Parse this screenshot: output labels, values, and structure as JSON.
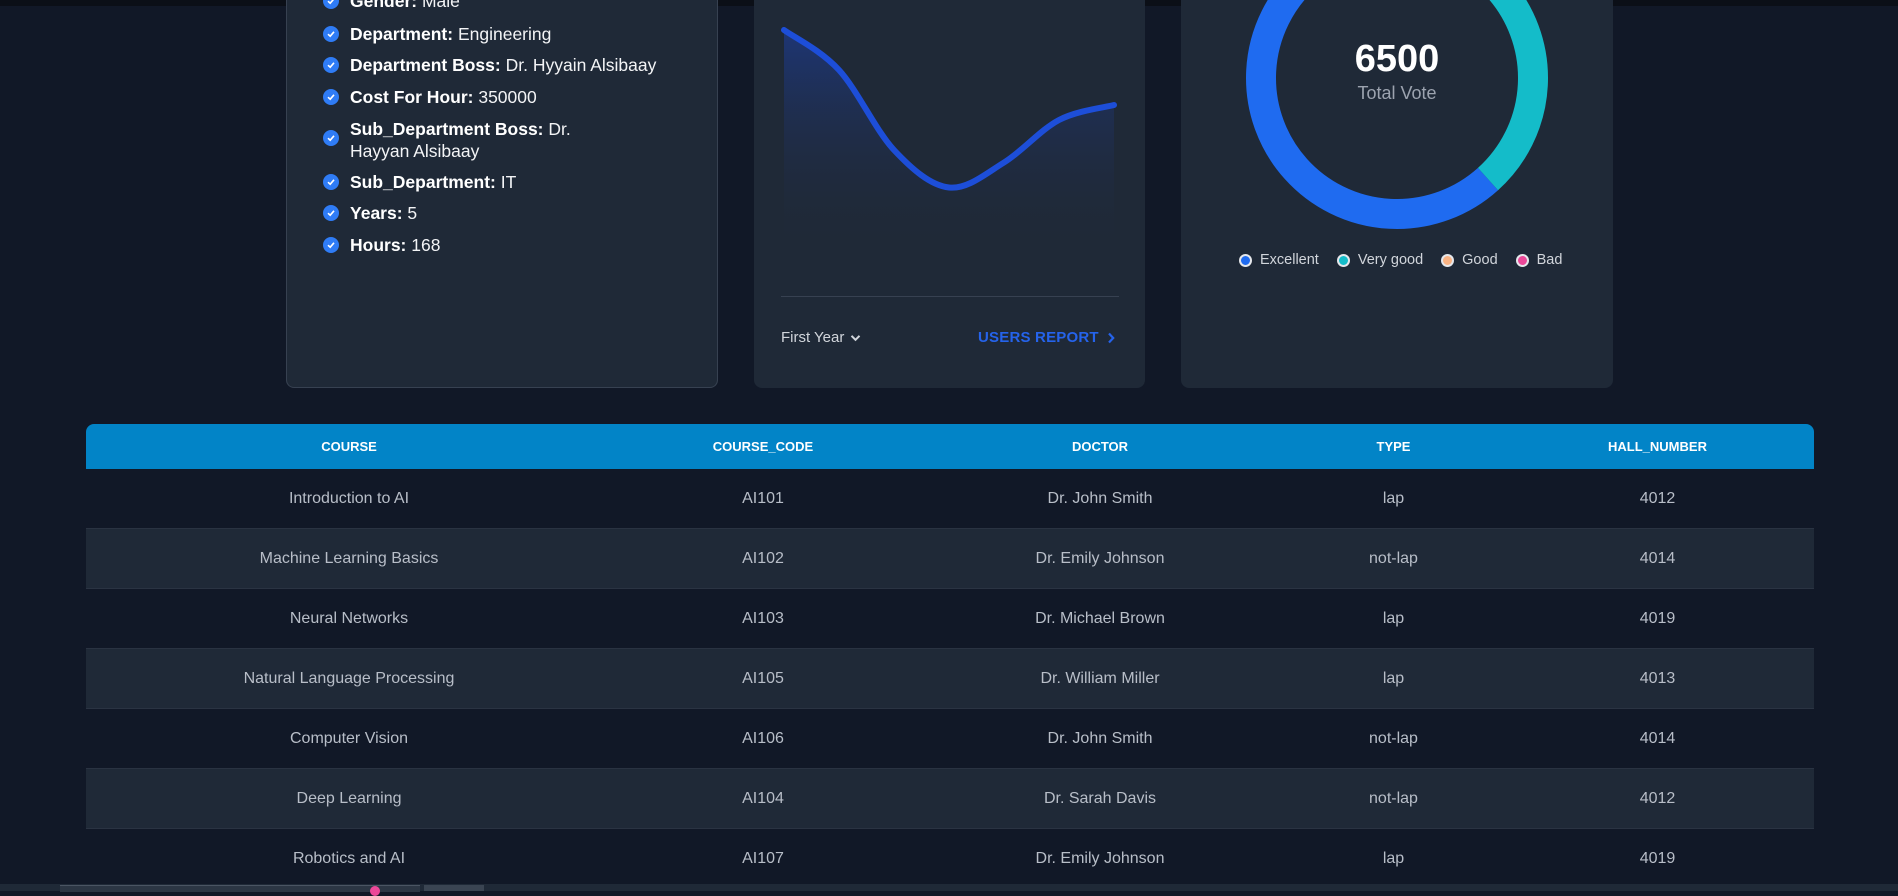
{
  "info": {
    "items": [
      {
        "key": "Gender:",
        "value": "Male"
      },
      {
        "key": "Department:",
        "value": "Engineering"
      },
      {
        "key": "Department Boss:",
        "value": "Dr. Hyyain Alsibaay"
      },
      {
        "key": "Cost For Hour:",
        "value": "350000"
      },
      {
        "key": "Sub_Department Boss:",
        "value": "Dr. Hayyan Alsibaay"
      },
      {
        "key": "Sub_Department:",
        "value": "IT"
      },
      {
        "key": "Years:",
        "value": "5"
      },
      {
        "key": "Hours:",
        "value": "168"
      }
    ]
  },
  "report": {
    "period_select": "First Year",
    "link_label": "USERS REPORT",
    "line_color": "#1d4ed8",
    "chart_data": {
      "type": "area",
      "series": [
        {
          "values": [
            88,
            72,
            40,
            25,
            35,
            52,
            58
          ]
        }
      ],
      "ylim": [
        0,
        100
      ],
      "grid": false
    }
  },
  "vote": {
    "total": "6500",
    "total_label": "Total Vote",
    "chart_data": {
      "type": "pie",
      "categories": [
        "Excellent",
        "Very good",
        "Good",
        "Bad"
      ],
      "values": [
        62,
        38,
        0,
        0
      ],
      "colors": [
        "#1f6bf0",
        "#14bcc9",
        "#f9b384",
        "#ec4899"
      ]
    },
    "legend": [
      {
        "label": "Excellent",
        "color": "#1f6bf0"
      },
      {
        "label": "Very good",
        "color": "#14bcc9"
      },
      {
        "label": "Good",
        "color": "#f9b384"
      },
      {
        "label": "Bad",
        "color": "#ec4899"
      }
    ]
  },
  "table": {
    "headers": [
      "COURSE",
      "COURSE_CODE",
      "DOCTOR",
      "TYPE",
      "HALL_NUMBER"
    ],
    "rows": [
      [
        "Introduction to AI",
        "AI101",
        "Dr. John Smith",
        "lap",
        "4012"
      ],
      [
        "Machine Learning Basics",
        "AI102",
        "Dr. Emily Johnson",
        "not-lap",
        "4014"
      ],
      [
        "Neural Networks",
        "AI103",
        "Dr. Michael Brown",
        "lap",
        "4019"
      ],
      [
        "Natural Language Processing",
        "AI105",
        "Dr. William Miller",
        "lap",
        "4013"
      ],
      [
        "Computer Vision",
        "AI106",
        "Dr. John Smith",
        "not-lap",
        "4014"
      ],
      [
        "Deep Learning",
        "AI104",
        "Dr. Sarah Davis",
        "not-lap",
        "4012"
      ],
      [
        "Robotics and AI",
        "AI107",
        "Dr. Emily Johnson",
        "lap",
        "4019"
      ]
    ]
  }
}
